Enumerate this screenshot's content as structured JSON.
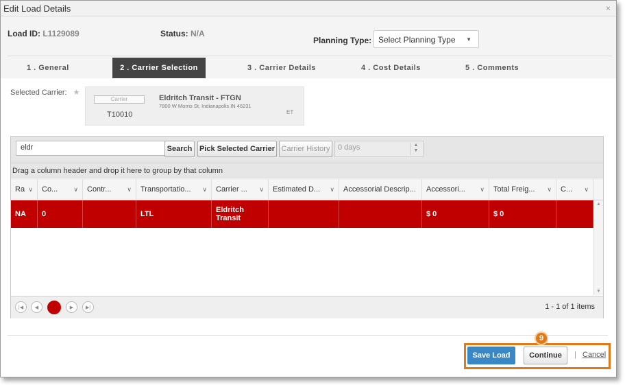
{
  "window": {
    "title": "Edit Load Details",
    "close_glyph": "×"
  },
  "header": {
    "load_id_label": "Load ID:",
    "load_id_value": "L1129089",
    "status_label": "Status:",
    "status_value": "N/A",
    "planning_type_label": "Planning Type:",
    "planning_type_value": "Select Planning Type"
  },
  "tabs": [
    {
      "label": "1 . General",
      "active": false
    },
    {
      "label": "2 . Carrier Selection",
      "active": true
    },
    {
      "label": "3 . Carrier Details",
      "active": false
    },
    {
      "label": "4 . Cost Details",
      "active": false
    },
    {
      "label": "5 . Comments",
      "active": false
    }
  ],
  "selected_carrier": {
    "label": "Selected Carrier:",
    "required_mark": "★",
    "logo_text": "Carrier",
    "code": "T10010",
    "name": "Eldritch Transit - FTGN",
    "address": "7800 W Morris St, Indianapolis IN 46231",
    "timezone": "ET"
  },
  "grid": {
    "search_value": "eldr",
    "search_button": "Search",
    "pick_button": "Pick Selected Carrier",
    "history_button": "Carrier History",
    "days_value": "0 days",
    "group_hint": "Drag a column header and drop it here to group by that column",
    "columns": [
      "Ra",
      "Co...",
      "Contr...",
      "Transportatio...",
      "Carrier ...",
      "Estimated D...",
      "Accessorial Descrip...",
      "Accessori...",
      "Total Freig...",
      "C..."
    ],
    "rows": [
      [
        "NA",
        "0",
        "",
        "LTL",
        "Eldritch Transit",
        "",
        "",
        "$ 0",
        "$ 0",
        ""
      ]
    ],
    "pager": {
      "current_page": "1",
      "info": "1 - 1 of 1 items"
    }
  },
  "footer": {
    "step_badge": "9",
    "save_label": "Save Load",
    "continue_label": "Continue",
    "separator": "|",
    "cancel_label": "Cancel"
  },
  "colors": {
    "selected_row": "#c00000",
    "save_button": "#3a87c6",
    "highlight_box": "#e07a18",
    "active_tab": "#444444"
  }
}
